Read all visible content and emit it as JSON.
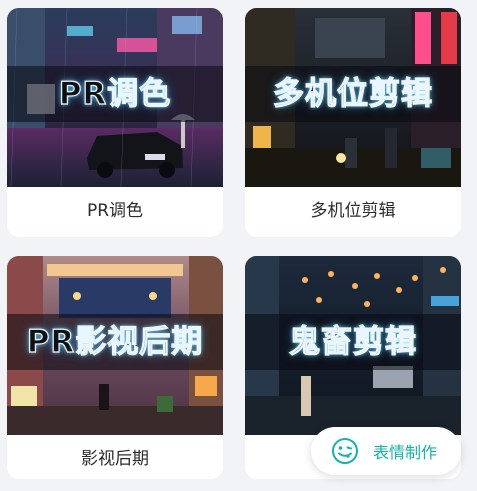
{
  "cards": [
    {
      "overlay": "PR调色",
      "title": "PR调色"
    },
    {
      "overlay": "多机位剪辑",
      "title": "多机位剪辑"
    },
    {
      "overlay": "PR影视后期",
      "title": "影视后期"
    },
    {
      "overlay": "鬼畜剪辑",
      "title": ""
    }
  ],
  "fab": {
    "label": "表情制作",
    "icon": "smiley-tongue-icon",
    "color": "#12b5a6"
  },
  "colors": {
    "background": "#f2f3f7",
    "card": "#ffffff",
    "accent": "#12b5a6"
  }
}
